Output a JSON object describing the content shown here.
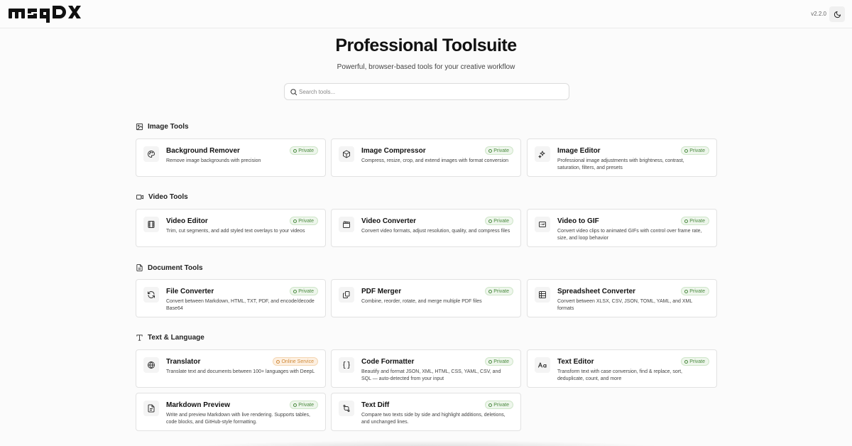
{
  "header": {
    "logo_text": "msqDX",
    "version": "v2.2.0"
  },
  "hero": {
    "title": "Professional Toolsuite",
    "subtitle": "Powerful, browser-based tools for your creative workflow"
  },
  "search": {
    "placeholder": "Search tools..."
  },
  "sections": [
    {
      "title": "Image Tools",
      "icon": "image-icon",
      "tools": [
        {
          "name": "Background Remover",
          "desc": "Remove image backgrounds with precision",
          "badge": "Private",
          "icon": "palette-icon"
        },
        {
          "name": "Image Compressor",
          "desc": "Compress, resize, crop, and extend images with format conversion",
          "badge": "Private",
          "icon": "box-icon"
        },
        {
          "name": "Image Editor",
          "desc": "Professional image adjustments with brightness, contrast, saturation, filters, and presets",
          "badge": "Private",
          "icon": "sparkles-icon"
        }
      ]
    },
    {
      "title": "Video Tools",
      "icon": "video-icon",
      "tools": [
        {
          "name": "Video Editor",
          "desc": "Trim, cut segments, and add styled text overlays to your videos",
          "badge": "Private",
          "icon": "film-icon"
        },
        {
          "name": "Video Converter",
          "desc": "Convert video formats, adjust resolution, quality, and compress files",
          "badge": "Private",
          "icon": "clapperboard-icon"
        },
        {
          "name": "Video to GIF",
          "desc": "Convert video clips to animated GIFs with control over frame rate, size, and loop behavior",
          "badge": "Private",
          "icon": "gif-icon"
        }
      ]
    },
    {
      "title": "Document Tools",
      "icon": "document-icon",
      "tools": [
        {
          "name": "File Converter",
          "desc": "Convert between Markdown, HTML, TXT, PDF, and encode/decode Base64",
          "badge": "Private",
          "icon": "refresh-icon"
        },
        {
          "name": "PDF Merger",
          "desc": "Combine, reorder, rotate, and merge multiple PDF files",
          "badge": "Private",
          "icon": "merge-icon"
        },
        {
          "name": "Spreadsheet Converter",
          "desc": "Convert between XLSX, CSV, JSON, TOML, YAML, and XML formats",
          "badge": "Private",
          "icon": "table-icon"
        }
      ]
    },
    {
      "title": "Text & Language",
      "icon": "type-icon",
      "tools": [
        {
          "name": "Translator",
          "desc": "Translate text and documents between 100+ languages with DeepL",
          "badge": "Online Service",
          "icon": "globe-icon"
        },
        {
          "name": "Code Formatter",
          "desc": "Beautify and format JSON, XML, HTML, CSS, YAML, CSV, and SQL — auto-detected from your input",
          "badge": "Private",
          "icon": "braces-icon"
        },
        {
          "name": "Text Editor",
          "desc": "Transform text with case conversion, find & replace, sort, deduplicate, count, and more",
          "badge": "Private",
          "icon": "case-icon"
        },
        {
          "name": "Markdown Preview",
          "desc": "Write and preview Markdown with live rendering. Supports tables, code blocks, and GitHub-style formatting.",
          "badge": "Private",
          "icon": "file-text-icon"
        },
        {
          "name": "Text Diff",
          "desc": "Compare two texts side by side and highlight additions, deletions, and unchanged lines.",
          "badge": "Private",
          "icon": "diff-icon"
        }
      ]
    }
  ],
  "colors": {
    "private_badge": "#4a8a3f",
    "online_badge": "#d08a3a",
    "border": "#e2e2e2"
  }
}
